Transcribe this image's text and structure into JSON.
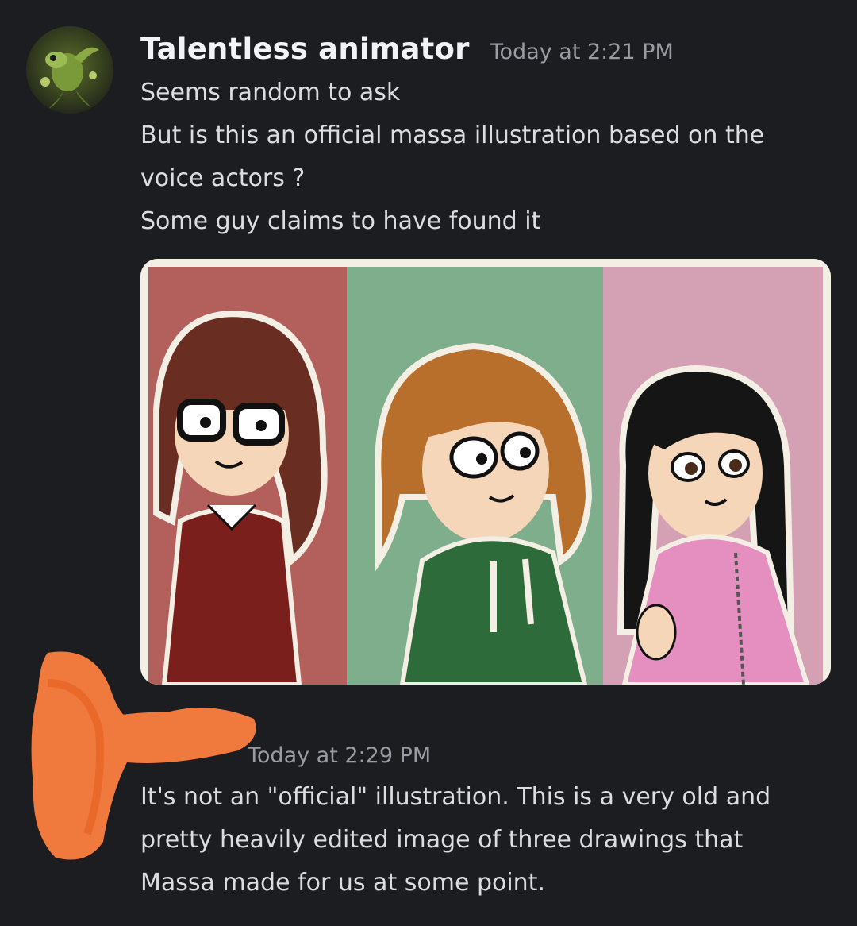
{
  "messages": [
    {
      "author": "Talentless animator",
      "timestamp": "Today at 2:21 PM",
      "lines": [
        "Seems random to ask",
        "But is this an official massa illustration based on the",
        "voice actors ?",
        "Some guy claims to have found it"
      ],
      "attachment": {
        "type": "image",
        "panel_colors": [
          "#b3605c",
          "#7fae8d",
          "#d3a0b4"
        ]
      }
    },
    {
      "author": "",
      "timestamp": "Today at 2:29 PM",
      "lines": [
        "It's not an \"official\" illustration. This is a very old and",
        "pretty heavily edited image of three drawings that",
        "Massa made for us at some point."
      ]
    }
  ],
  "colors": {
    "background": "#1c1d21",
    "author_text": "#f2f3f5",
    "message_text": "#dbdee1",
    "timestamp_text": "#9a9ca3",
    "redaction_scribble": "#f07a3e"
  }
}
